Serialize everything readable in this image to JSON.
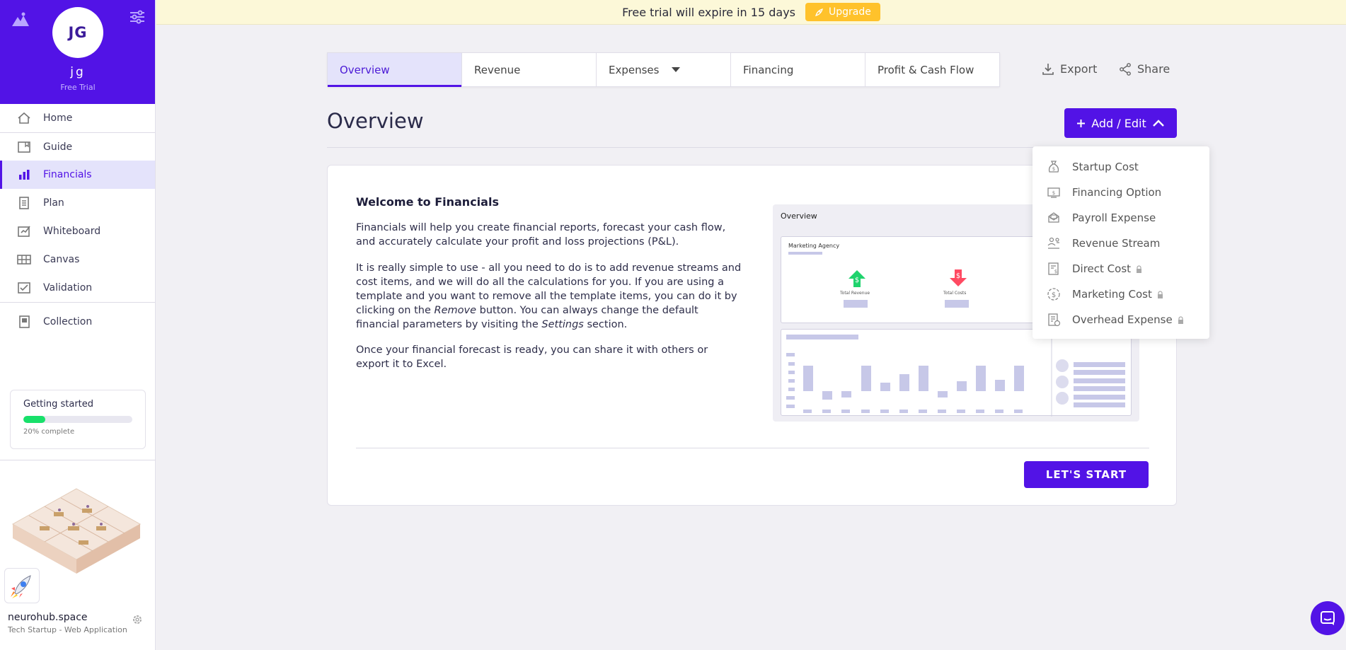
{
  "user": {
    "initials": "JG",
    "name": "jg",
    "tier": "Free Trial"
  },
  "nav": [
    {
      "label": "Home",
      "icon": "home-icon"
    },
    {
      "label": "Guide",
      "icon": "guide-icon"
    },
    {
      "label": "Financials",
      "icon": "bar-chart-icon",
      "active": true
    },
    {
      "label": "Plan",
      "icon": "plan-icon"
    },
    {
      "label": "Whiteboard",
      "icon": "whiteboard-icon"
    },
    {
      "label": "Canvas",
      "icon": "canvas-icon"
    },
    {
      "label": "Validation",
      "icon": "validation-icon"
    },
    {
      "label": "Collection",
      "icon": "collection-icon"
    }
  ],
  "getting_started": {
    "title": "Getting started",
    "progress": 0.2,
    "progress_label": "20% complete"
  },
  "workspace": {
    "name": "neurohub.space",
    "type": "Tech Startup - Web Application"
  },
  "banner": {
    "text": "Free trial will expire in 15 days",
    "upgrade_label": "Upgrade"
  },
  "tabs": [
    {
      "label": "Overview",
      "active": true
    },
    {
      "label": "Revenue"
    },
    {
      "label": "Expenses",
      "dropdown": true
    },
    {
      "label": "Financing"
    },
    {
      "label": "Profit & Cash Flow"
    }
  ],
  "actions": {
    "export": "Export",
    "share": "Share"
  },
  "page_title": "Overview",
  "add_edit_label": "Add / Edit",
  "card": {
    "heading": "Welcome to Financials",
    "p1": "Financials will help you create financial reports, forecast your cash flow, and accurately calculate your profit and loss projections (P&L).",
    "p2_a": "It is really simple to use - all you need to do is to add revenue streams and cost items, and we will do all the calculations for you. If you are using a template and you want to remove all the template items, you can do it by clicking on the ",
    "p2_remove": "Remove",
    "p2_b": " button. You can always change the default financial parameters by visiting the ",
    "p2_settings": "Settings",
    "p2_c": " section.",
    "p3": "Once your financial forecast is ready, you can share it with others or export it to Excel.",
    "start_label": "LET'S START"
  },
  "preview": {
    "title": "Overview",
    "company": "Marketing Agency",
    "total_revenue": "Total Revenue",
    "total_costs": "Total Costs"
  },
  "dropdown": [
    {
      "label": "Startup Cost",
      "icon": "money-bag-icon",
      "locked": false
    },
    {
      "label": "Financing Option",
      "icon": "financing-icon",
      "locked": false
    },
    {
      "label": "Payroll Expense",
      "icon": "payroll-icon",
      "locked": false
    },
    {
      "label": "Revenue Stream",
      "icon": "revenue-stream-icon",
      "locked": false
    },
    {
      "label": "Direct Cost",
      "icon": "direct-cost-icon",
      "locked": true
    },
    {
      "label": "Marketing Cost",
      "icon": "marketing-cost-icon",
      "locked": true
    },
    {
      "label": "Overhead Expense",
      "icon": "overhead-icon",
      "locked": true
    }
  ],
  "colors": {
    "primary": "#5213e6",
    "accent_yellow": "#ffc22b",
    "progress_green": "#18e06a",
    "banner_bg": "#fcf8d8"
  }
}
